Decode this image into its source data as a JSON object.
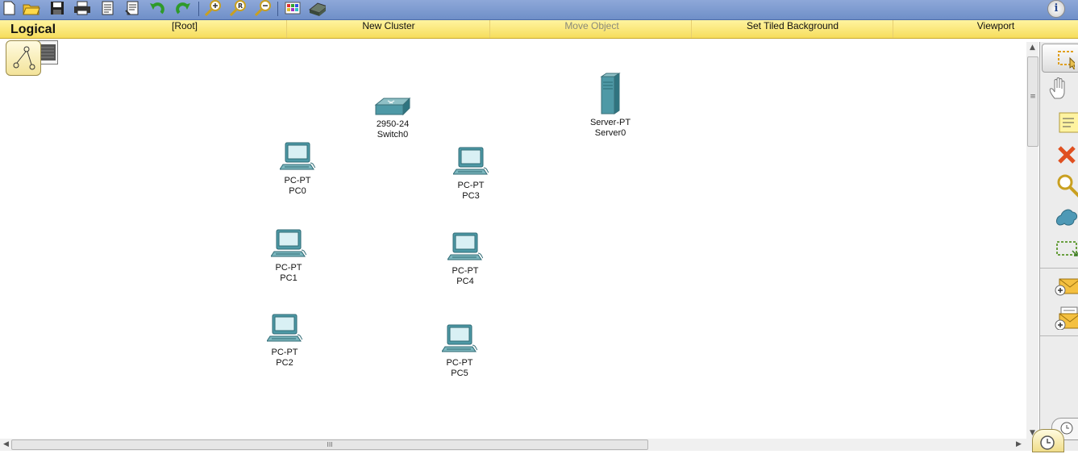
{
  "toolbar": {
    "buttons": [
      "new-icon",
      "open-icon",
      "save-icon",
      "print-icon",
      "activity-wizard-icon",
      "custom-device-icon",
      "undo-icon",
      "redo-icon",
      "zoom-in-icon",
      "zoom-reset-icon",
      "zoom-out-icon",
      "palette-icon",
      "device-template-icon"
    ],
    "info_label": "i"
  },
  "logical_bar": {
    "title": "Logical",
    "items": [
      {
        "label": "[Root]",
        "enabled": true
      },
      {
        "label": "New Cluster",
        "enabled": true
      },
      {
        "label": "Move Object",
        "enabled": false
      },
      {
        "label": "Set Tiled Background",
        "enabled": true
      },
      {
        "label": "Viewport",
        "enabled": true
      }
    ]
  },
  "devices": [
    {
      "model": "2950-24",
      "name": "Switch0",
      "kind": "switch"
    },
    {
      "model": "Server-PT",
      "name": "Server0",
      "kind": "server"
    },
    {
      "model": "PC-PT",
      "name": "PC0",
      "kind": "pc"
    },
    {
      "model": "PC-PT",
      "name": "PC3",
      "kind": "pc"
    },
    {
      "model": "PC-PT",
      "name": "PC1",
      "kind": "pc"
    },
    {
      "model": "PC-PT",
      "name": "PC4",
      "kind": "pc"
    },
    {
      "model": "PC-PT",
      "name": "PC2",
      "kind": "pc"
    },
    {
      "model": "PC-PT",
      "name": "PC5",
      "kind": "pc"
    }
  ],
  "palette": {
    "tools": [
      "select-icon",
      "hand-icon",
      "note-icon",
      "delete-icon",
      "inspect-icon",
      "draw-shape-icon",
      "resize-icon",
      "add-simple-pdu-icon",
      "add-complex-pdu-icon"
    ]
  },
  "scroll": {
    "hgrip": "III",
    "vgrip": "≡"
  }
}
